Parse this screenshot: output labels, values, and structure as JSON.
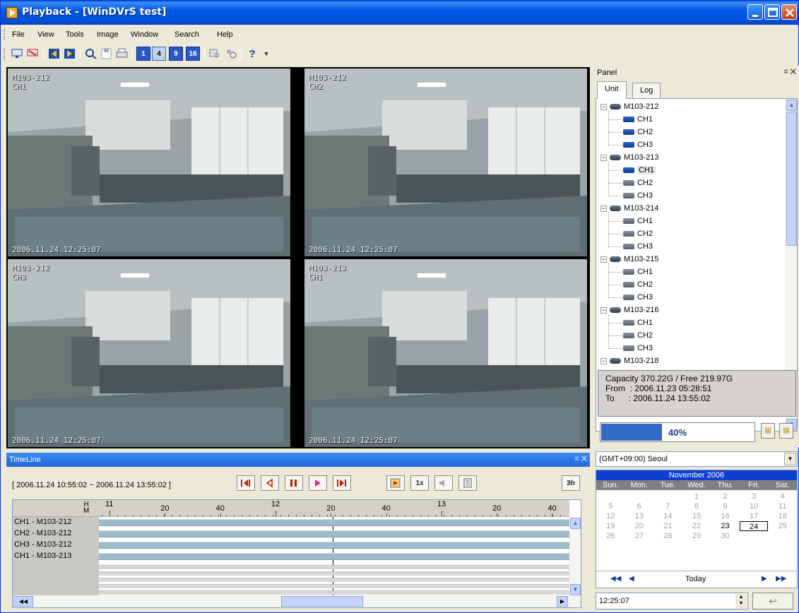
{
  "window": {
    "title": "Playback - [WinDVrS test]"
  },
  "menu": [
    "File",
    "View",
    "Tools",
    "Image",
    "Window",
    "Search",
    "Help"
  ],
  "toolbar": {
    "view_buttons": [
      "1",
      "4",
      "9",
      "16"
    ]
  },
  "cameras": [
    {
      "unit": "M103-212",
      "channel": "CH1",
      "timestamp": "2006.11.24 12:25:07"
    },
    {
      "unit": "M103-212",
      "channel": "CH2",
      "timestamp": "2006.11.24 12:25:07"
    },
    {
      "unit": "M103-212",
      "channel": "CH3",
      "timestamp": "2006.11.24 12:25:07"
    },
    {
      "unit": "M103-213",
      "channel": "CH1",
      "timestamp": "2006.11.24 12:25:07"
    }
  ],
  "panel": {
    "title": "Panel",
    "tabs": [
      "Unit",
      "Log"
    ],
    "tree": [
      {
        "unit": "M103-212",
        "channels": [
          "CH1",
          "CH2",
          "CH3"
        ]
      },
      {
        "unit": "M103-213",
        "channels": [
          "CH1",
          "CH2",
          "CH3"
        ]
      },
      {
        "unit": "M103-214",
        "channels": [
          "CH1",
          "CH2",
          "CH3"
        ]
      },
      {
        "unit": "M103-215",
        "channels": [
          "CH1",
          "CH2",
          "CH3"
        ]
      },
      {
        "unit": "M103-216",
        "channels": [
          "CH1",
          "CH2",
          "CH3"
        ]
      },
      {
        "unit": "M103-218",
        "channels": []
      }
    ],
    "capacity": "Capacity 370.22G / Free 219.97G",
    "from": "From  : 2006.11.23 05:28:51",
    "to": "To      : 2006.11.24 13:55:02",
    "progress_percent": 40,
    "progress_label": "40%"
  },
  "timeline": {
    "title": "TimeLine",
    "range": "[ 2006.11.24 10:55:02 ~ 2006.11.24 13:55:02 ]",
    "speed": "1x",
    "hours_button": "3h",
    "hm_label_h": "H",
    "hm_label_m": "M",
    "ruler": [
      {
        "text": "11",
        "hour": true
      },
      {
        "text": "20",
        "hour": false
      },
      {
        "text": "40",
        "hour": false
      },
      {
        "text": "12",
        "hour": true
      },
      {
        "text": "20",
        "hour": false
      },
      {
        "text": "40",
        "hour": false
      },
      {
        "text": "13",
        "hour": true
      },
      {
        "text": "20",
        "hour": false
      },
      {
        "text": "40",
        "hour": false
      }
    ],
    "rows": [
      "CH1 - M103-212",
      "CH2 - M103-212",
      "CH3 - M103-212",
      "CH1 - M103-213"
    ]
  },
  "calendar": {
    "timezone": "(GMT+09:00) Seoul",
    "month": "November 2006",
    "weekdays": [
      "Sun.",
      "Mon.",
      "Tue.",
      "Wed.",
      "Thu.",
      "Fri.",
      "Sat."
    ],
    "weeks": [
      [
        "",
        "",
        "",
        "1",
        "2",
        "3",
        "4"
      ],
      [
        "5",
        "6",
        "7",
        "8",
        "9",
        "10",
        "11"
      ],
      [
        "12",
        "13",
        "14",
        "15",
        "16",
        "17",
        "18"
      ],
      [
        "19",
        "20",
        "21",
        "22",
        "23",
        "24",
        "25"
      ],
      [
        "26",
        "27",
        "28",
        "29",
        "30",
        "",
        ""
      ]
    ],
    "recorded_days": [
      "23",
      "24"
    ],
    "selected_day": "24",
    "today_label": "Today",
    "time": "12:25:07"
  }
}
